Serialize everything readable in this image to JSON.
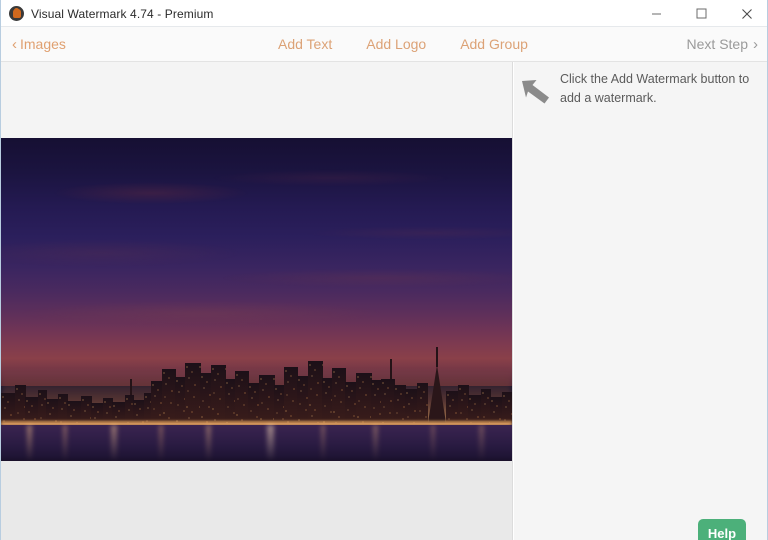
{
  "window": {
    "title": "Visual Watermark 4.74 - Premium",
    "app_icon": "padlock-icon",
    "controls": {
      "minimize": "minimize-icon",
      "maximize": "maximize-icon",
      "close": "close-icon"
    }
  },
  "toolbar": {
    "back_chevron": "‹",
    "back_label": "Images",
    "items": [
      {
        "label": "Add Text"
      },
      {
        "label": "Add Logo"
      },
      {
        "label": "Add Group"
      }
    ],
    "next_label": "Next Step",
    "next_chevron": "›"
  },
  "canvas": {
    "photo_alt": "San Francisco skyline at dusk over the bay"
  },
  "info_panel": {
    "arrow_icon": "arrow-up-left-icon",
    "hint_text": "Click the Add Watermark button to add a watermark."
  },
  "help": {
    "label": "Help"
  },
  "colors": {
    "accent_orange": "#dca276",
    "disabled_gray": "#9a9a9a",
    "help_green": "#4cb07a",
    "toolbar_bg": "#fafafa",
    "panel_bg": "#f5f5f5",
    "canvas_bg": "#e9e9e9"
  }
}
